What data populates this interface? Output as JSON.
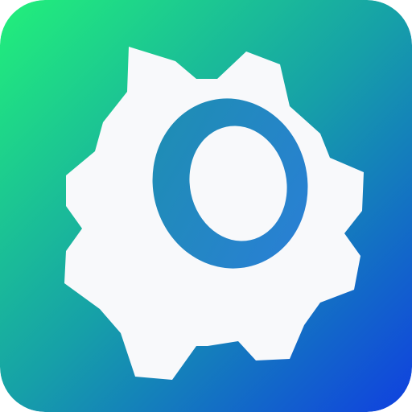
{
  "icon": {
    "name": "gear-icon",
    "colors": {
      "gradient_start": "#22f07a",
      "gradient_mid": "#16a0a8",
      "gradient_end": "#1040e0",
      "gear": "#f8f9fb",
      "ring_start": "#1d8fb0",
      "ring_end": "#2a7ed8",
      "hub": "#f8f9fb"
    }
  }
}
